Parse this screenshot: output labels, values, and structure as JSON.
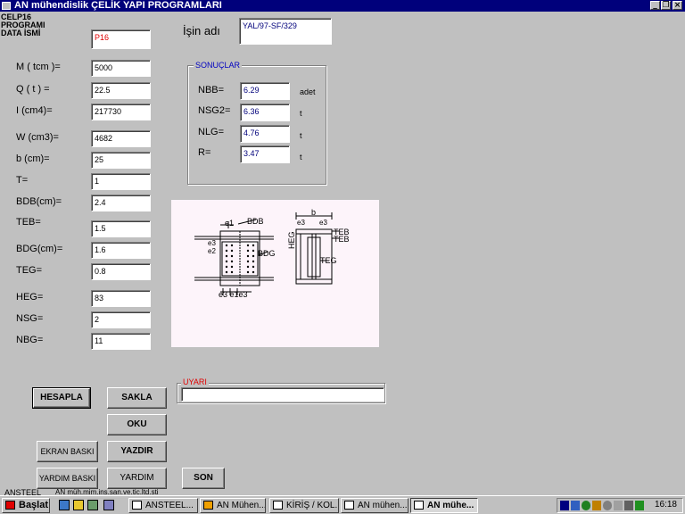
{
  "window": {
    "title": "AN mühendislik  ÇELİK YAPI PROGRAMLARI",
    "controls": [
      "_",
      "❐",
      "×"
    ]
  },
  "header": {
    "program_lines": [
      "CELP16",
      "PROGRAMI",
      "DATA  İSMİ"
    ],
    "data_name": "P16",
    "job_label": "İşin adı",
    "job_value": "YAL/97-SF/329"
  },
  "inputs": [
    {
      "label": "M ( tcm )=",
      "value": "5000"
    },
    {
      "label": "Q ( t ) =",
      "value": "22.5"
    },
    {
      "label": " I (cm4)=",
      "value": "217730"
    },
    {
      "label": "W (cm3)=",
      "value": "4682"
    },
    {
      "label": "b (cm)=",
      "value": "25"
    },
    {
      "label": "T=",
      "value": "1"
    },
    {
      "label": "BDB(cm)=",
      "value": "2.4"
    },
    {
      "label": "TEB=",
      "value": "1.5"
    },
    {
      "label": "BDG(cm)=",
      "value": "1.6"
    },
    {
      "label": "TEG=",
      "value": "0.8"
    },
    {
      "label": " HEG=",
      "value": "83"
    },
    {
      "label": "NSG=",
      "value": "2"
    },
    {
      "label": "NBG=",
      "value": "11"
    }
  ],
  "results": {
    "title": "SONUÇLAR",
    "rows": [
      {
        "label": "NBB=",
        "value": "6.29",
        "unit": "adet"
      },
      {
        "label": "NSG2=",
        "value": "6.36",
        "unit": "t"
      },
      {
        "label": "NLG=",
        "value": "4.76",
        "unit": "t"
      },
      {
        "label": "R=",
        "value": "3.47",
        "unit": "t"
      }
    ]
  },
  "diagram": {
    "labels": {
      "e1": "e1",
      "bdb": "BDB",
      "bdg": "BDG",
      "e3a": "e3",
      "e2": "e2",
      "bottom": "e3 e1e3",
      "b": "b",
      "e3l": "e3",
      "e3r": "e3",
      "teb1": "TEB",
      "teb2": "TEB",
      "heg": "HEG",
      "teg": "TEG"
    }
  },
  "warning": {
    "title": "UYARI",
    "value": ""
  },
  "buttons": {
    "hesapla": "HESAPLA",
    "sakla": "SAKLA",
    "oku": "OKU",
    "ekran_baski": "EKRAN BASKI",
    "yazdir": "YAZDIR",
    "yardim_baski": "YARDIM BASKI",
    "yardim": "YARDIM",
    "son": "SON"
  },
  "status": {
    "left": "ANSTEEL",
    "right": "AN müh.mim.ins.san.ve.tic.ltd.sti"
  },
  "taskbar": {
    "start": "Başlat",
    "tasks": [
      "ANSTEEL...",
      "AN Mühen...",
      "KİRİŞ / KOL...",
      "AN mühen...",
      "AN mühe..."
    ],
    "clock": "16:18"
  },
  "colors": {
    "titlebar": "#00007b",
    "face": "#c0c0c0",
    "diagram_bg": "#fdf4fa",
    "warning_title": "#e00000",
    "result_title": "#0000c0"
  }
}
